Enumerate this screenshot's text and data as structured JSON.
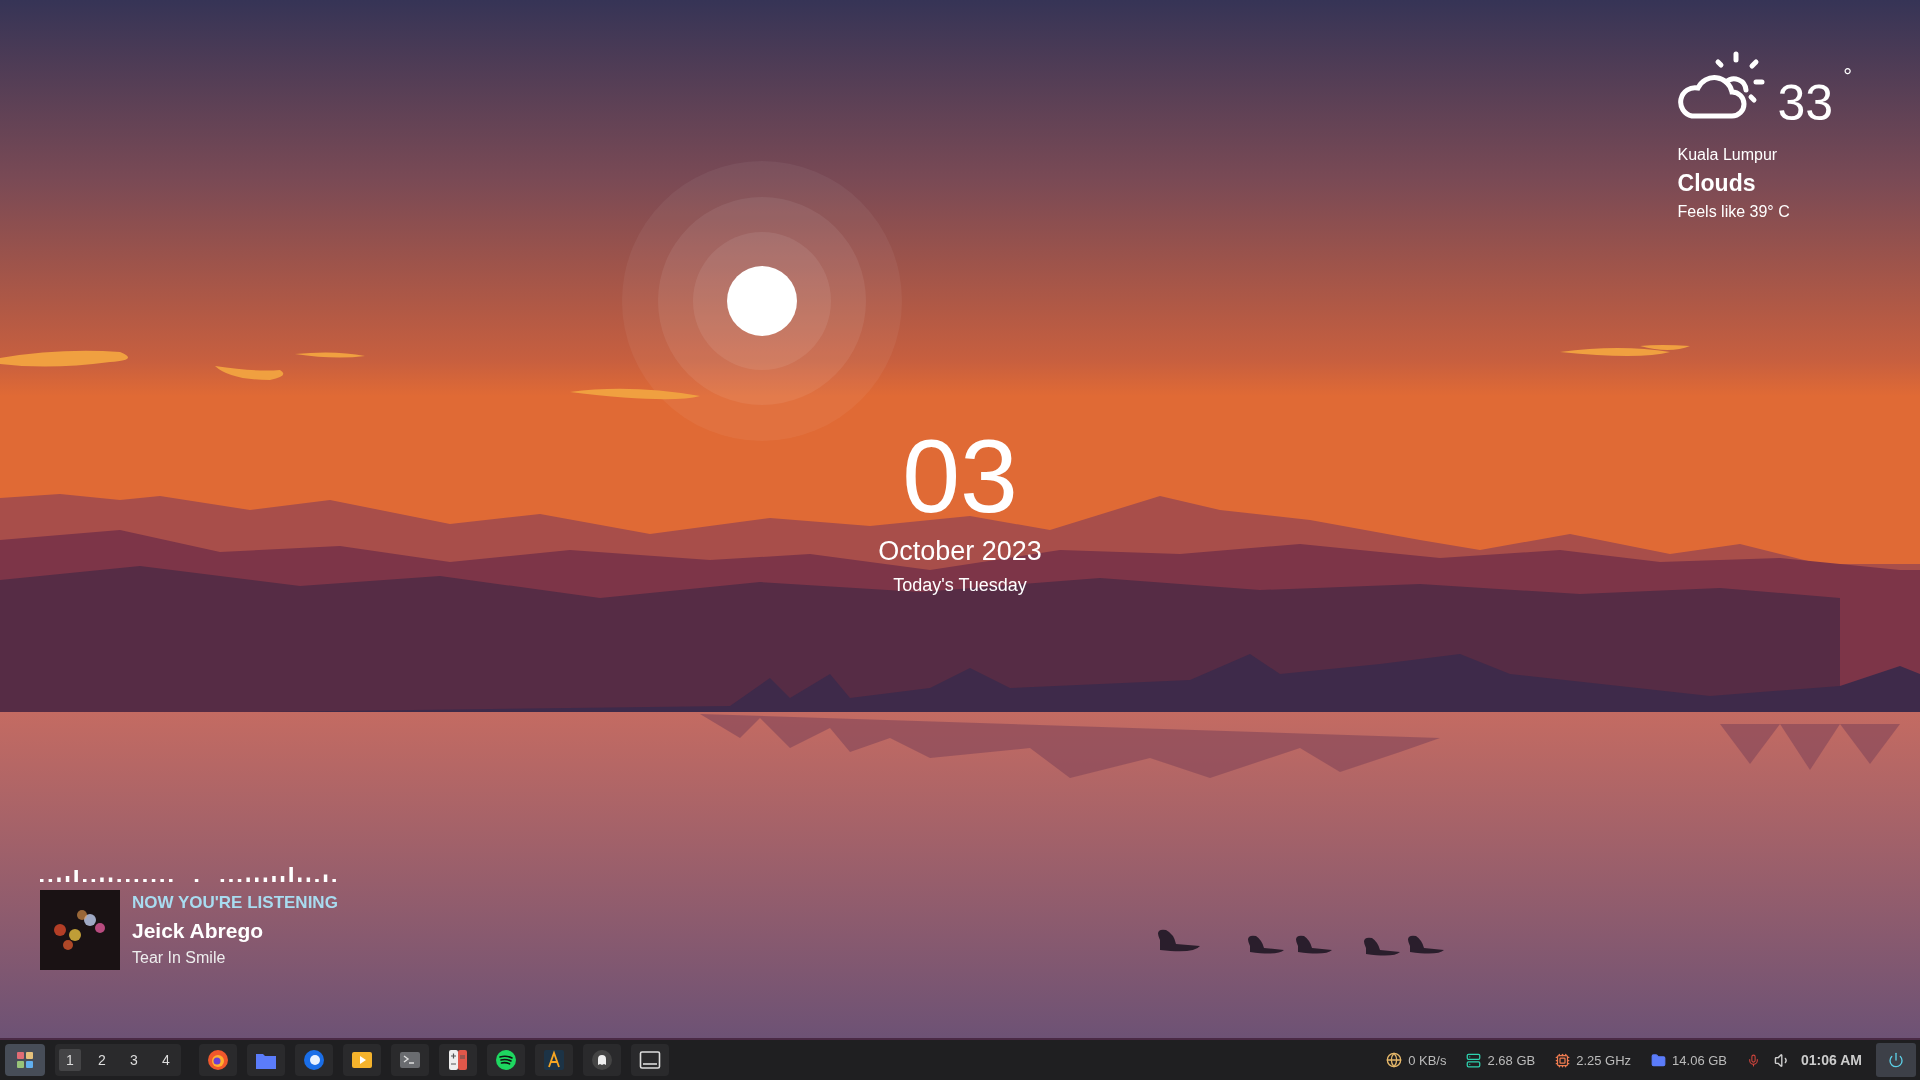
{
  "weather": {
    "temperature": "33",
    "degree": "°",
    "city": "Kuala Lumpur",
    "condition": "Clouds",
    "feels_like": "Feels like 39° C"
  },
  "clock": {
    "day": "03",
    "month_year": "October 2023",
    "weekday": "Today's Tuesday"
  },
  "player": {
    "heading": "NOW YOU'RE LISTENING",
    "artist": "Jeick Abrego",
    "title": "Tear In Smile"
  },
  "taskbar": {
    "workspaces": [
      {
        "label": "1",
        "selected": true
      },
      {
        "label": "2",
        "selected": false
      },
      {
        "label": "3",
        "selected": false
      },
      {
        "label": "4",
        "selected": false
      }
    ],
    "apps": [
      {
        "kind": "browser"
      },
      {
        "kind": "files"
      },
      {
        "kind": "mail"
      },
      {
        "kind": "player"
      },
      {
        "kind": "terminal"
      },
      {
        "kind": "calculator"
      },
      {
        "kind": "music"
      },
      {
        "kind": "editor"
      },
      {
        "kind": "ghost"
      },
      {
        "kind": "display"
      }
    ],
    "status": [
      {
        "kind": "network",
        "text": "0 KB/s"
      },
      {
        "kind": "memory",
        "text": "2.68 GB"
      },
      {
        "kind": "cpu",
        "text": "2.25 GHz"
      },
      {
        "kind": "disk",
        "text": "14.06 GB"
      }
    ],
    "time": "01:06 AM"
  }
}
